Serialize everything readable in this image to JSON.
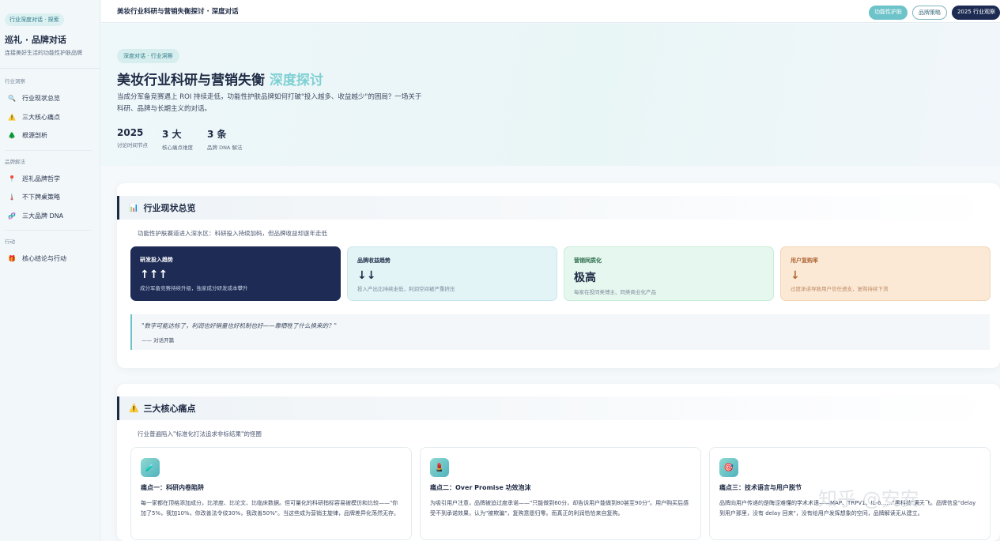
{
  "sidebar": {
    "tag": "行业深度对话 · 探索",
    "brand": "巡礼 · 品牌对话",
    "subtitle": "连接美好生活的功能性护肤品牌",
    "sections": [
      {
        "title": "行业洞察",
        "items": [
          {
            "icon": "search-icon",
            "glyph": "🔍",
            "label": "行业现状总览"
          },
          {
            "icon": "warning-icon",
            "glyph": "⚠️",
            "label": "三大核心痛点"
          },
          {
            "icon": "tree-icon",
            "glyph": "🌲",
            "label": "根源剖析"
          }
        ]
      },
      {
        "title": "品牌解法",
        "items": [
          {
            "icon": "pin-icon",
            "glyph": "📍",
            "label": "巡礼品牌哲学"
          },
          {
            "icon": "thermometer-icon",
            "glyph": "🌡️",
            "label": "不下牌桌策略"
          },
          {
            "icon": "dna-icon",
            "glyph": "🧬",
            "label": "三大品牌 DNA"
          }
        ]
      },
      {
        "title": "行动",
        "items": [
          {
            "icon": "gift-icon",
            "glyph": "🎁",
            "label": "核心结论与行动"
          }
        ]
      }
    ]
  },
  "topbar": {
    "title": "美妆行业科研与营销失衡探讨 · 深度对话",
    "pills": [
      "功能性护肤",
      "品牌策略",
      "2025 行业观察"
    ]
  },
  "hero": {
    "tag": "深度对话 · 行业洞察",
    "title_main": "美妆行业科研与营销失衡",
    "title_accent": "深度探讨",
    "description": "当成分军备竞赛遇上 ROI 持续走低，功能性护肤品牌如何打破\"投入越多、收益越少\"的困局？一场关于科研、品牌与长期主义的对话。",
    "stats": [
      {
        "value": "2025",
        "label": "讨论时间节点"
      },
      {
        "value": "3 大",
        "label": "核心痛点维度"
      },
      {
        "value": "3 条",
        "label": "品牌 DNA 解法"
      }
    ]
  },
  "overview": {
    "icon": "chart-icon",
    "glyph": "📊",
    "title": "行业现状总览",
    "subtitle": "功能性护肤赛道进入深水区：科研投入持续加码，但品牌收益却逐年走低",
    "trends": [
      {
        "label": "研发投入趋势",
        "value": "↑↑↑",
        "desc": "成分军备竞赛持续升级，独家成分研发成本攀升"
      },
      {
        "label": "品牌收益趋势",
        "value": "↓↓",
        "desc": "投入产出比持续走低，利润空间被严重挤压"
      },
      {
        "label": "营销同质化",
        "value": "极高",
        "desc": "每家在投同类博主、同类商业化产品"
      },
      {
        "label": "用户复购率",
        "value": "↓",
        "desc": "过度承诺导致用户信任透支，复购持续下滑"
      }
    ],
    "quote": "\"数字可能达标了，利润也好销量也好机制也好——靠牺牲了什么换来的？\"",
    "quote_author": "—— 对话开篇"
  },
  "painpoints": {
    "icon": "warning-icon",
    "glyph": "⚠️",
    "title": "三大核心痛点",
    "subtitle": "行业普遍陷入\"标准化打法追求非标结果\"的怪圈",
    "items": [
      {
        "icon": "syringe-icon",
        "glyph": "🧪",
        "title": "痛点一：科研内卷陷阱",
        "desc": "每一家都在顶格添加成分，比浓度、比论文、比临床数据。但可量化的科研指标容易被模仿和比较——\"你加了5%，我加10%，你改善法令纹30%，我改善50%\"。当这些成为营销主旋律，品牌差异化荡然无存。"
      },
      {
        "icon": "lipstick-icon",
        "glyph": "💄",
        "title": "痛点二：Over Promise 功效泡沫",
        "desc": "为吸引用户注意，品牌被迫过度承诺——\"只能做到60分，却告诉用户能做到80甚至90分\"。用户购买后感受不到承诺效果，认为\"被欺骗\"，复购意愿归零。而真正的利润恰恰来自复购。"
      },
      {
        "icon": "target-icon",
        "glyph": "🎯",
        "title": "痛点三：技术语言与用户脱节",
        "desc": "品牌向用户传递的是晦涩难懂的学术术语——MAP、TRPV1、IL-6……\"黑科技\"满天飞。品牌信息\"delay 到用户那里，没有 delay 回来\"，没有给用户发挥想象的空间，品牌解读无从建立。"
      }
    ]
  },
  "watermark": "知乎 @安安"
}
